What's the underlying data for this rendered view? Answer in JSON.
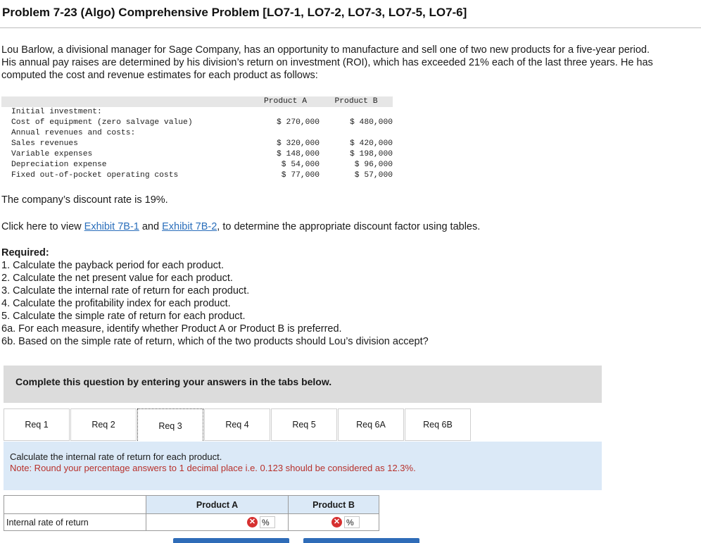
{
  "title": "Problem 7-23 (Algo) Comprehensive Problem [LO7-1, LO7-2, LO7-3, LO7-5, LO7-6]",
  "intro": "Lou Barlow, a divisional manager for Sage Company, has an opportunity to manufacture and sell one of two new products for a five-year period. His annual pay raises are determined by his division’s return on investment (ROI), which has exceeded 21% each of the last three years. He has computed the cost and revenue estimates for each product as follows:",
  "data_table": {
    "col_a": "Product A",
    "col_b": "Product B",
    "rows": [
      {
        "label": "Initial investment:",
        "a": "",
        "b": ""
      },
      {
        "label": "Cost of equipment (zero salvage value)",
        "a": "$ 270,000",
        "b": "$ 480,000"
      },
      {
        "label": "Annual revenues and costs:",
        "a": "",
        "b": ""
      },
      {
        "label": "Sales revenues",
        "a": "$ 320,000",
        "b": "$ 420,000"
      },
      {
        "label": "Variable expenses",
        "a": "$ 148,000",
        "b": "$ 198,000"
      },
      {
        "label": "Depreciation expense",
        "a": "$ 54,000",
        "b": "$ 96,000"
      },
      {
        "label": "Fixed out-of-pocket operating costs",
        "a": "$ 77,000",
        "b": "$ 57,000"
      }
    ]
  },
  "discount_text": "The company’s discount rate is 19%.",
  "click_prefix": "Click here to view ",
  "exhibit1": "Exhibit 7B-1",
  "click_and": " and ",
  "exhibit2": "Exhibit 7B-2",
  "click_suffix": ", to determine the appropriate discount factor using tables.",
  "required": {
    "heading": "Required:",
    "items": [
      "1. Calculate the payback period for each product.",
      "2. Calculate the net present value for each product.",
      "3. Calculate the internal rate of return for each product.",
      "4. Calculate the profitability index for each product.",
      "5. Calculate the simple rate of return for each product.",
      "6a. For each measure, identify whether Product A or Product B is preferred.",
      "6b. Based on the simple rate of return, which of the two products should Lou’s division accept?"
    ]
  },
  "banner": "Complete this question by entering your answers in the tabs below.",
  "tabs": [
    "Req 1",
    "Req 2",
    "Req 3",
    "Req 4",
    "Req 5",
    "Req 6A",
    "Req 6B"
  ],
  "active_tab": "Req 3",
  "panel": {
    "instruction": "Calculate the internal rate of return for each product.",
    "note": "Note: Round your percentage answers to 1 decimal place i.e. 0.123 should be considered as 12.3%."
  },
  "answer_table": {
    "col_a": "Product A",
    "col_b": "Product B",
    "row_label": "Internal rate of return",
    "value_a": "",
    "value_b": "",
    "unit": "%",
    "status_icon": "x-circle-icon",
    "status_color": "#d63030"
  },
  "colors": {
    "link": "#2a6ebb",
    "panel_bg": "#dbe9f7",
    "note": "#b7312c",
    "nav_button": "#2f6cb8"
  }
}
